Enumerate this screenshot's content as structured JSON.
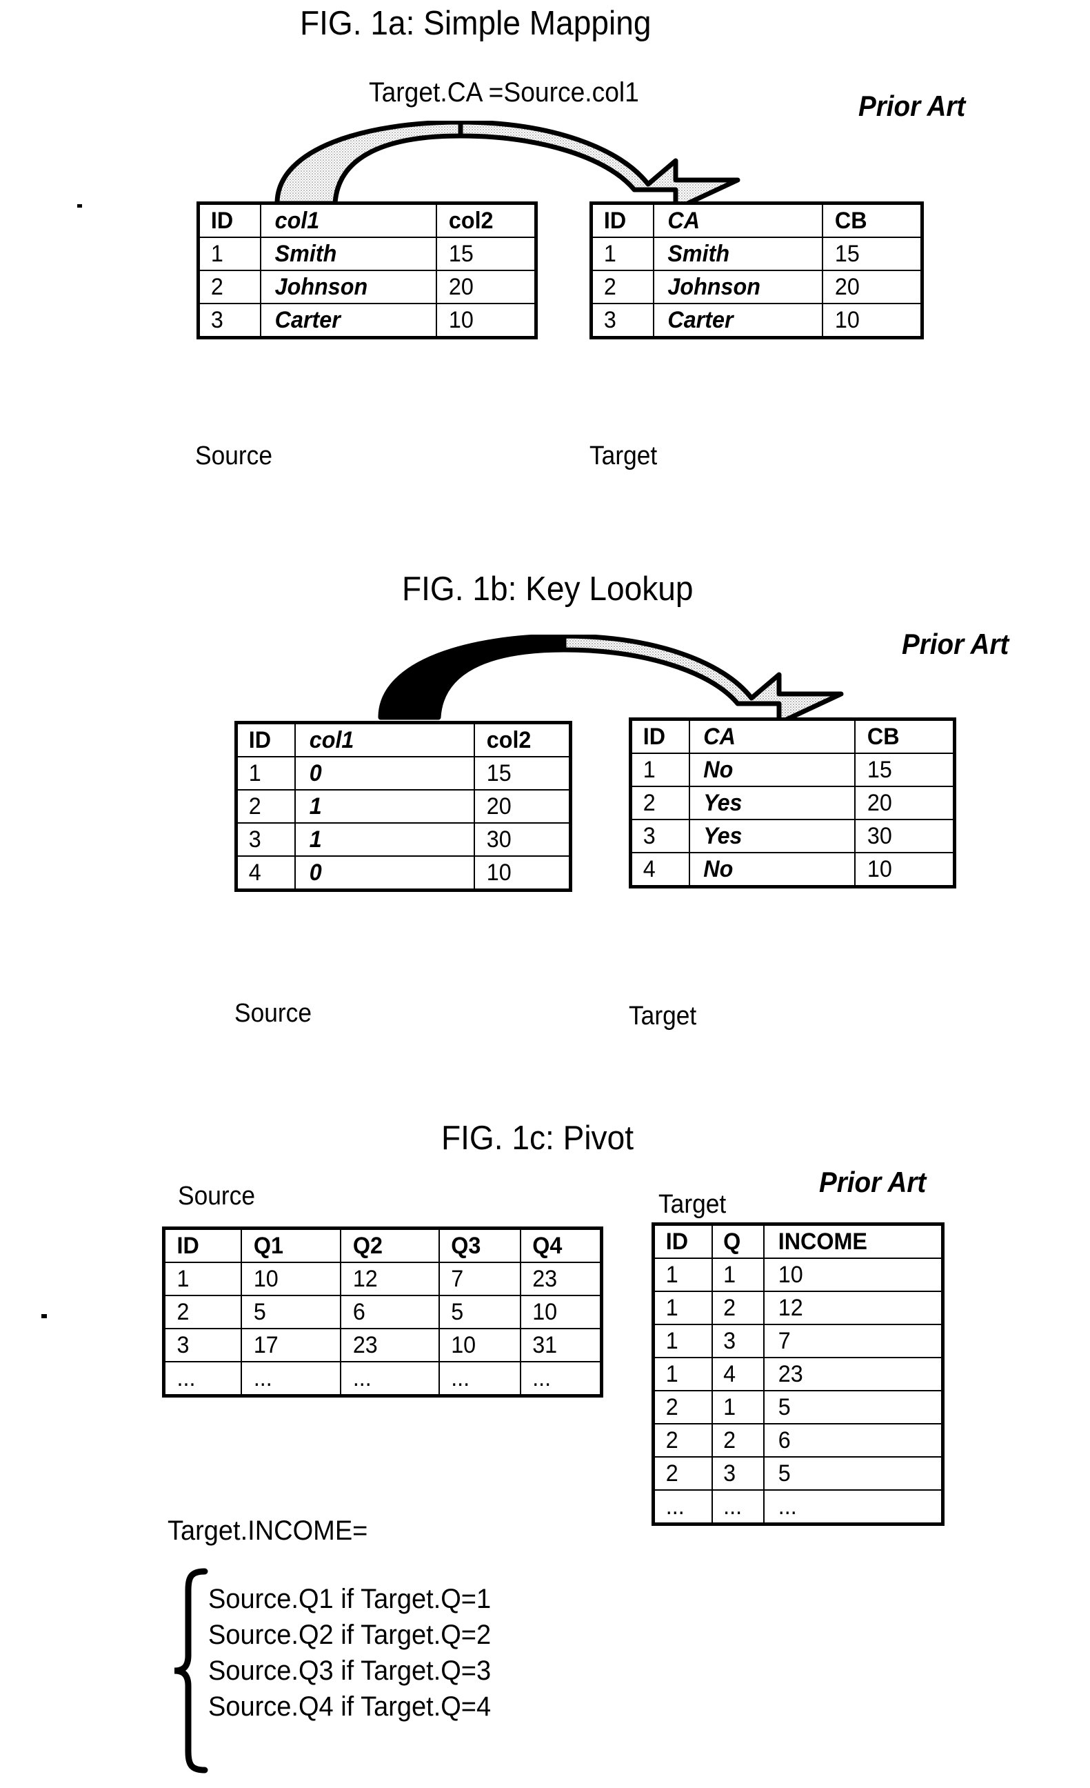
{
  "page": {
    "background": "#ffffff",
    "ink": "#000000"
  },
  "figures": [
    {
      "id": "fig-1a",
      "title": "FIG. 1a: Simple Mapping",
      "prior_art": "Prior Art",
      "expression": "Target.CA  =Source.col1",
      "arrow": {
        "type": "curved-arch-arrow",
        "fill": "stipple",
        "direction": "left-to-right"
      },
      "source": {
        "caption": "Source",
        "headers": [
          "ID",
          "col1",
          "col2"
        ],
        "rows": [
          [
            "1",
            "Smith",
            "15"
          ],
          [
            "2",
            "Johnson",
            "20"
          ],
          [
            "3",
            "Carter",
            "10"
          ]
        ]
      },
      "target": {
        "caption": "Target",
        "headers": [
          "ID",
          "CA",
          "CB"
        ],
        "rows": [
          [
            "1",
            "Smith",
            "15"
          ],
          [
            "2",
            "Johnson",
            "20"
          ],
          [
            "3",
            "Carter",
            "10"
          ]
        ]
      }
    },
    {
      "id": "fig-1b",
      "title": "FIG. 1b:  Key Lookup",
      "prior_art": "Prior Art",
      "arrow": {
        "type": "curved-arch-arrow",
        "fill": "half-solid-half-stipple",
        "direction": "left-to-right"
      },
      "source": {
        "caption": "Source",
        "headers": [
          "ID",
          "col1",
          "col2"
        ],
        "rows": [
          [
            "1",
            "0",
            "15"
          ],
          [
            "2",
            "1",
            "20"
          ],
          [
            "3",
            "1",
            "30"
          ],
          [
            "4",
            "0",
            "10"
          ]
        ]
      },
      "target": {
        "caption": "Target",
        "headers": [
          "ID",
          "CA",
          "CB"
        ],
        "rows": [
          [
            "1",
            "No",
            "15"
          ],
          [
            "2",
            "Yes",
            "20"
          ],
          [
            "3",
            "Yes",
            "30"
          ],
          [
            "4",
            "No",
            "10"
          ]
        ]
      }
    },
    {
      "id": "fig-1c",
      "title": "FIG. 1c: Pivot",
      "prior_art": "Prior Art",
      "source": {
        "caption": "Source",
        "headers": [
          "ID",
          "Q1",
          "Q2",
          "Q3",
          "Q4"
        ],
        "rows": [
          [
            "1",
            "10",
            "12",
            "7",
            "23"
          ],
          [
            "2",
            "5",
            "6",
            "5",
            "10"
          ],
          [
            "3",
            "17",
            "23",
            "10",
            "31"
          ],
          [
            "...",
            "...",
            "...",
            "...",
            "..."
          ]
        ]
      },
      "target": {
        "caption": "Target",
        "headers": [
          "ID",
          "Q",
          "INCOME"
        ],
        "rows": [
          [
            "1",
            "1",
            "10"
          ],
          [
            "1",
            "2",
            "12"
          ],
          [
            "1",
            "3",
            "7"
          ],
          [
            "1",
            "4",
            "23"
          ],
          [
            "2",
            "1",
            "5"
          ],
          [
            "2",
            "2",
            "6"
          ],
          [
            "2",
            "3",
            "5"
          ],
          [
            "...",
            "...",
            "..."
          ]
        ]
      },
      "formula": {
        "heading": "Target.INCOME=",
        "lines": [
          "Source.Q1 if Target.Q=1",
          "Source.Q2 if Target.Q=2",
          "Source.Q3 if Target.Q=3",
          "Source.Q4 if Target.Q=4"
        ]
      }
    }
  ]
}
